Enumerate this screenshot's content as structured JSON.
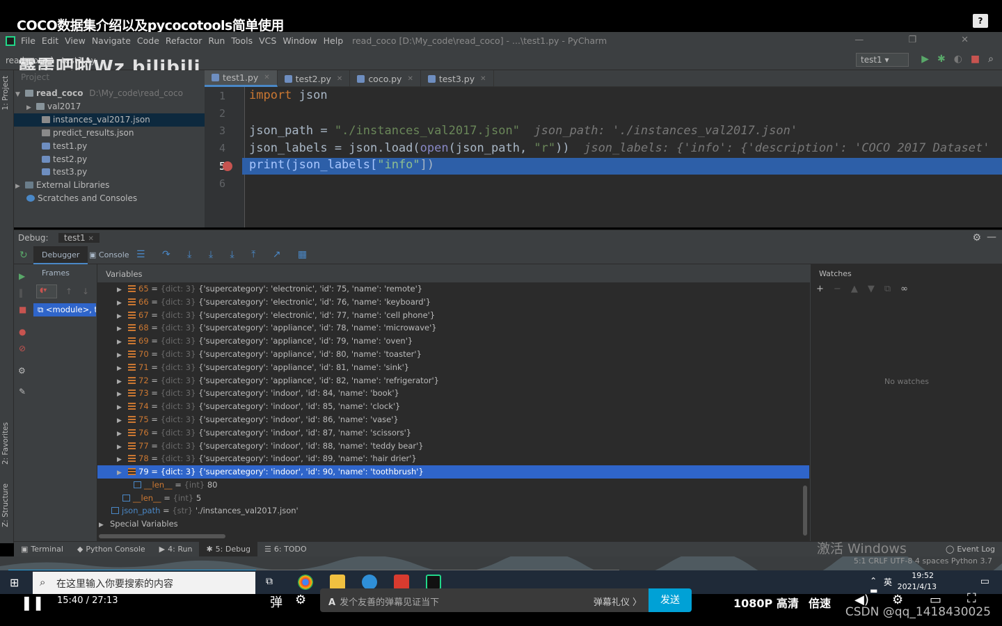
{
  "video_title": "COCO数据集介绍以及pycocotools简单使用",
  "help_icon": "?",
  "menu": {
    "items": [
      "File",
      "Edit",
      "View",
      "Navigate",
      "Code",
      "Refactor",
      "Run",
      "Tools",
      "VCS",
      "Window",
      "Help"
    ],
    "window_title": "read_coco [D:\\My_code\\read_coco] - ...\\test1.py - PyCharm",
    "window_controls": "— ❐ ✕"
  },
  "nav": {
    "crumbs": "read_coco  〉 test1.py",
    "run_config": "test1 ▾"
  },
  "watermark": "霹雳吧啦Wz bilibili",
  "project": {
    "header": "Project",
    "root": "read_coco",
    "root_path": "D:\\My_code\\read_coco",
    "items": [
      "val2017",
      "instances_val2017.json",
      "predict_results.json",
      "test1.py",
      "test2.py",
      "test3.py"
    ],
    "external": "External Libraries",
    "scratches": "Scratches and Consoles"
  },
  "side_labels": {
    "project": "1: Project",
    "favorites": "2: Favorites",
    "structure": "Z: Structure"
  },
  "tabs": [
    "test1.py",
    "test2.py",
    "coco.py",
    "test3.py"
  ],
  "editor": {
    "line_numbers": [
      "1",
      "2",
      "3",
      "4",
      "5",
      "6"
    ],
    "l1_kw": "import",
    "l1_mod": " json",
    "l3_var": "json_path = ",
    "l3_str": "\"./instances_val2017.json\"",
    "l3_hint": "  json_path: './instances_val2017.json'",
    "l4_a": "json_labels = json.load(",
    "l4_fn": "open",
    "l4_b": "(json_path, ",
    "l4_str": "\"r\"",
    "l4_c": "))",
    "l4_hint": "  json_labels: {'info': {'description': 'COCO 2017 Dataset'",
    "l5_a": "print(json_labels[",
    "l5_str": "\"info\"",
    "l5_b": "])"
  },
  "debug": {
    "label": "Debug:",
    "session": "test1",
    "debugger_tab": "Debugger",
    "console_tab": "Console",
    "frames_header": "Frames",
    "frame_item": "<module>, t",
    "variables_header": "Variables",
    "watches_header": "Watches",
    "no_watches": "No watches"
  },
  "variables": [
    {
      "idx": "65",
      "type": "{dict: 3}",
      "val": "{'supercategory': 'electronic', 'id': 75, 'name': 'remote'}"
    },
    {
      "idx": "66",
      "type": "{dict: 3}",
      "val": "{'supercategory': 'electronic', 'id': 76, 'name': 'keyboard'}"
    },
    {
      "idx": "67",
      "type": "{dict: 3}",
      "val": "{'supercategory': 'electronic', 'id': 77, 'name': 'cell phone'}"
    },
    {
      "idx": "68",
      "type": "{dict: 3}",
      "val": "{'supercategory': 'appliance', 'id': 78, 'name': 'microwave'}"
    },
    {
      "idx": "69",
      "type": "{dict: 3}",
      "val": "{'supercategory': 'appliance', 'id': 79, 'name': 'oven'}"
    },
    {
      "idx": "70",
      "type": "{dict: 3}",
      "val": "{'supercategory': 'appliance', 'id': 80, 'name': 'toaster'}"
    },
    {
      "idx": "71",
      "type": "{dict: 3}",
      "val": "{'supercategory': 'appliance', 'id': 81, 'name': 'sink'}"
    },
    {
      "idx": "72",
      "type": "{dict: 3}",
      "val": "{'supercategory': 'appliance', 'id': 82, 'name': 'refrigerator'}"
    },
    {
      "idx": "73",
      "type": "{dict: 3}",
      "val": "{'supercategory': 'indoor', 'id': 84, 'name': 'book'}"
    },
    {
      "idx": "74",
      "type": "{dict: 3}",
      "val": "{'supercategory': 'indoor', 'id': 85, 'name': 'clock'}"
    },
    {
      "idx": "75",
      "type": "{dict: 3}",
      "val": "{'supercategory': 'indoor', 'id': 86, 'name': 'vase'}"
    },
    {
      "idx": "76",
      "type": "{dict: 3}",
      "val": "{'supercategory': 'indoor', 'id': 87, 'name': 'scissors'}"
    },
    {
      "idx": "77",
      "type": "{dict: 3}",
      "val": "{'supercategory': 'indoor', 'id': 88, 'name': 'teddy bear'}"
    },
    {
      "idx": "78",
      "type": "{dict: 3}",
      "val": "{'supercategory': 'indoor', 'id': 89, 'name': 'hair drier'}"
    },
    {
      "idx": "79",
      "type": "{dict: 3}",
      "val": "{'supercategory': 'indoor', 'id': 90, 'name': 'toothbrush'}"
    }
  ],
  "var_len_inner": {
    "name": "__len__",
    "type": "{int}",
    "val": "80"
  },
  "var_len_outer": {
    "name": "__len__",
    "type": "{int}",
    "val": "5"
  },
  "var_json_path": {
    "name": "json_path",
    "type": "{str}",
    "val": "'./instances_val2017.json'"
  },
  "special_vars": "Special Variables",
  "bottom_tabs": [
    "Terminal",
    "Python Console",
    "4: Run",
    "5: Debug",
    "6: TODO"
  ],
  "event_log": "Event Log",
  "activate_windows": "激活 Windows",
  "status_text": "5:1  CRLF  UTF-8  4 spaces  Python 3.7",
  "taskbar": {
    "search_placeholder": "在这里输入你要搜索的内容",
    "time": "19:52",
    "date": "2021/4/13",
    "ime": "英"
  },
  "player": {
    "time": "15:40 / 27:13",
    "danmu_placeholder": "发个友善的弹幕见证当下",
    "danmu_etiquette": "弹幕礼仪 〉",
    "send": "发送",
    "quality": "1080P 高清",
    "speed": "倍速"
  },
  "csdn": "CSDN @qq_1418430025"
}
